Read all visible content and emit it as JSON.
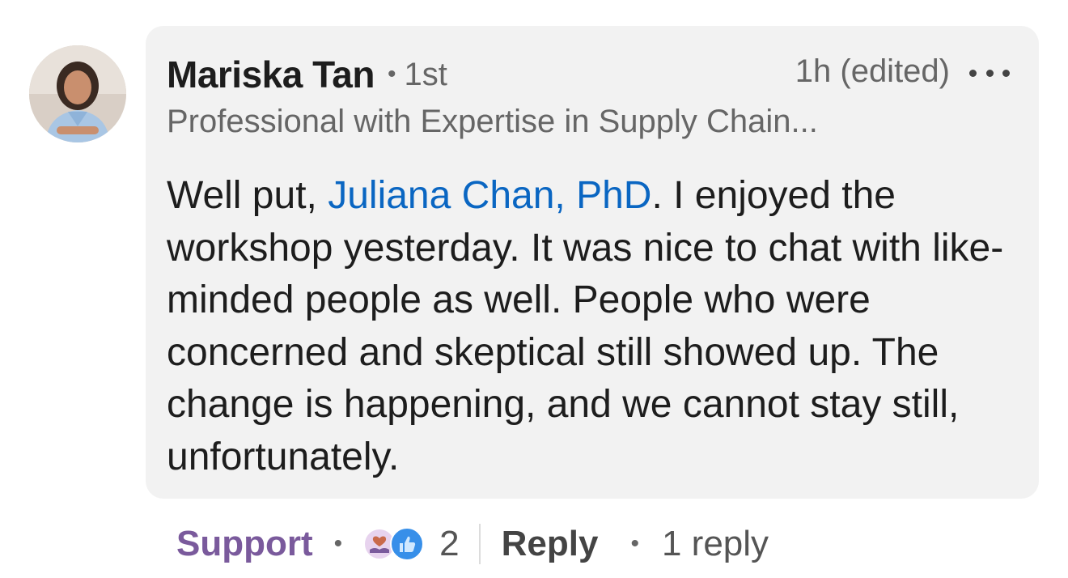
{
  "comment": {
    "author": {
      "name": "Mariska Tan",
      "connection_degree": "1st",
      "headline": "Professional with Expertise in Supply Chain...",
      "avatar_icon": "profile-photo"
    },
    "timestamp": "1h (edited)",
    "more_icon": "ellipsis-icon",
    "body": {
      "prefix": "Well put, ",
      "mention": "Juliana Chan, PhD",
      "suffix": ". I enjoyed the workshop yesterday. It was nice to chat with like-minded people as well. People who were concerned and skeptical still showed up. The change is happening, and we cannot stay still, unfortunately."
    },
    "colors": {
      "bubble_bg": "#f2f2f2",
      "mention": "#0a66c2",
      "support_action": "#7a5a9c",
      "like_blue": "#378fe9"
    }
  },
  "actions": {
    "support_label": "Support",
    "reaction_icons": [
      "support-reaction-icon",
      "like-reaction-icon"
    ],
    "reaction_count": "2",
    "reply_label": "Reply",
    "reply_count_label": "1 reply"
  }
}
